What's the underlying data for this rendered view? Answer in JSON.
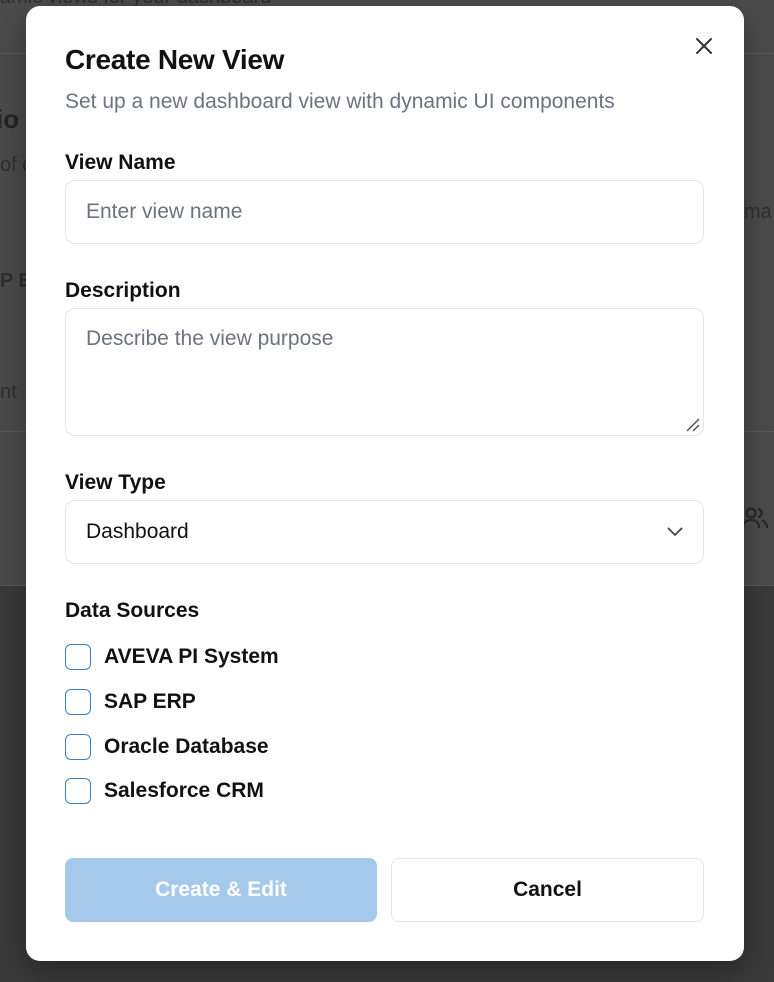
{
  "background": {
    "heading_fragment": "io",
    "text_fragments": [
      "amic views for your dashboard",
      "of c",
      "P E",
      "nt",
      "ma"
    ]
  },
  "modal": {
    "title": "Create New View",
    "subtitle": "Set up a new dashboard view with dynamic UI components",
    "view_name": {
      "label": "View Name",
      "placeholder": "Enter view name",
      "value": ""
    },
    "description": {
      "label": "Description",
      "placeholder": "Describe the view purpose",
      "value": ""
    },
    "view_type": {
      "label": "View Type",
      "selected": "Dashboard"
    },
    "data_sources": {
      "label": "Data Sources",
      "options": [
        {
          "label": "AVEVA PI System",
          "checked": false
        },
        {
          "label": "SAP ERP",
          "checked": false
        },
        {
          "label": "Oracle Database",
          "checked": false
        },
        {
          "label": "Salesforce CRM",
          "checked": false
        }
      ]
    },
    "buttons": {
      "create_label": "Create & Edit",
      "cancel_label": "Cancel"
    }
  },
  "colors": {
    "accent": "#3b82c4",
    "primary_disabled": "#a5c9ea",
    "overlay": "#3b3b3b"
  }
}
